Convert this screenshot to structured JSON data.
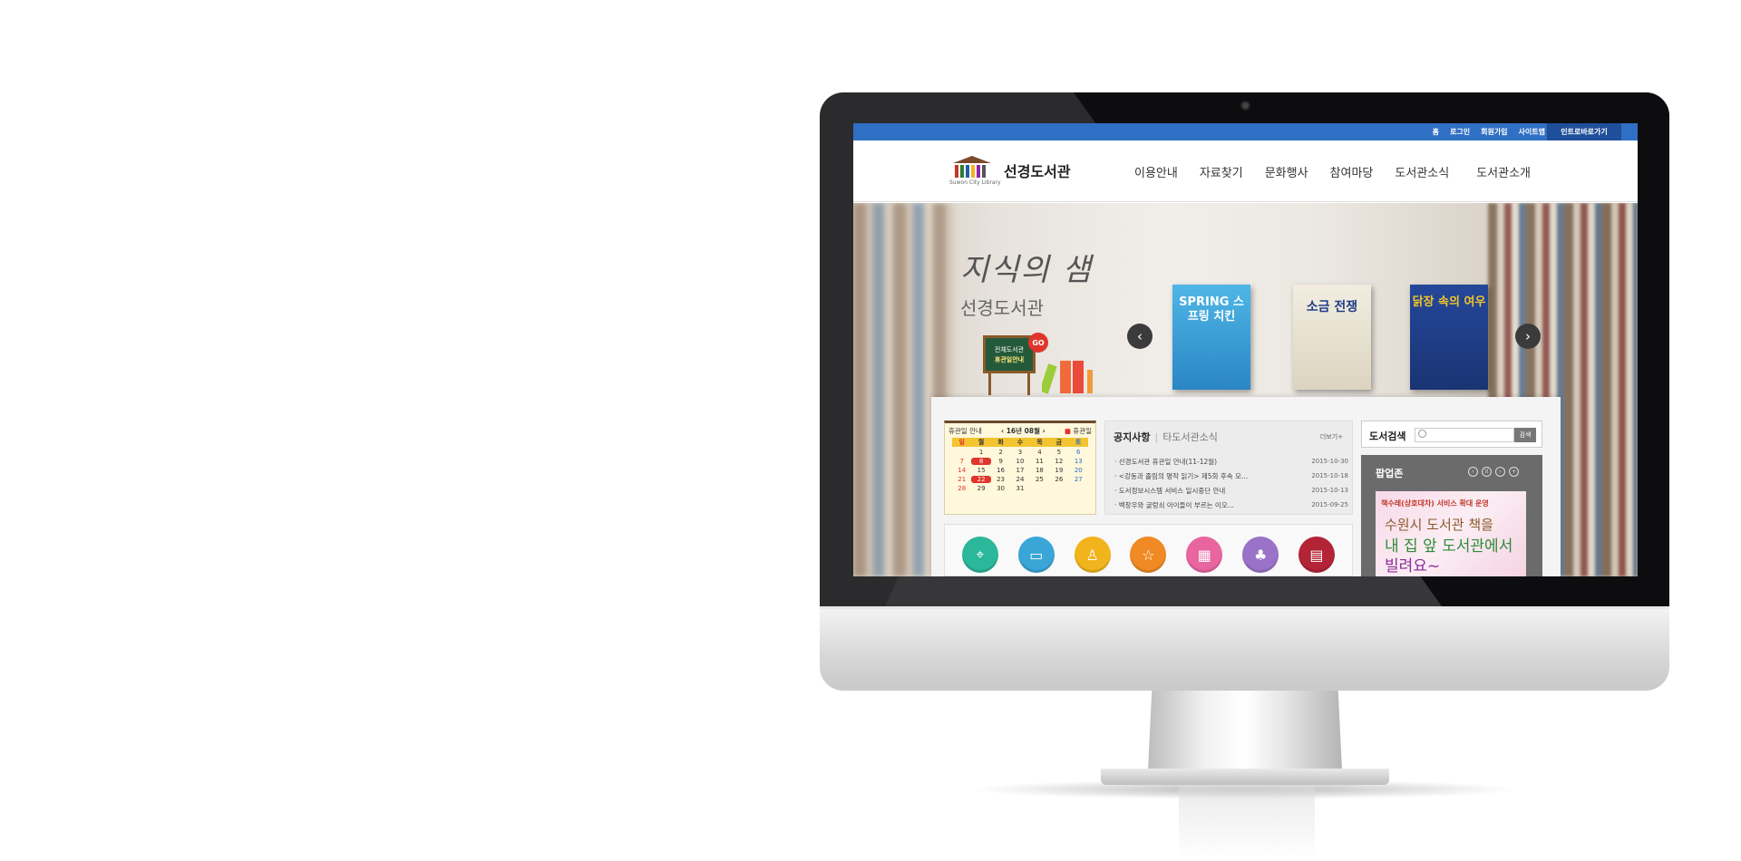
{
  "util_nav": [
    "홈",
    "로그인",
    "회원가입",
    "사이트맵"
  ],
  "intranet_label": "인트로바로가기",
  "logo": {
    "name": "선경도서관",
    "sub": "Suwon City Library"
  },
  "gnb": [
    "이용안내",
    "자료찾기",
    "문화행사",
    "참여마당",
    "도서관소식",
    "도서관소개"
  ],
  "hero": {
    "script_title": "지식의 샘",
    "title": "선경도서관",
    "board_line1": "전체도서관",
    "board_line2": "휴관일안내",
    "go_label": "GO",
    "books": [
      {
        "title": "SPRING 스프링 치킨",
        "color": "#3aa0d8"
      },
      {
        "title": "소금 전쟁",
        "color": "#e9e4d6"
      },
      {
        "title": "닭장 속의 여우",
        "color": "#1f3e8a"
      }
    ]
  },
  "calendar": {
    "title": "휴관일 안내",
    "month": "16년 08월",
    "legend": "휴관일",
    "dow": [
      "일",
      "월",
      "화",
      "수",
      "목",
      "금",
      "토"
    ],
    "days": [
      "",
      "1",
      "2",
      "3",
      "4",
      "5",
      "6",
      "7",
      "8",
      "9",
      "10",
      "11",
      "12",
      "13",
      "14",
      "15",
      "16",
      "17",
      "18",
      "19",
      "20",
      "21",
      "22",
      "23",
      "24",
      "25",
      "26",
      "27",
      "28",
      "29",
      "30",
      "31",
      "",
      "",
      ""
    ],
    "holidays": [
      "8",
      "22"
    ]
  },
  "notice": {
    "tab_active": "공지사항",
    "tab_other": "타도서관소식",
    "more": "더보기+",
    "items": [
      {
        "title": "선경도서관 휴관일 안내(11-12월)",
        "date": "2015-10-30"
      },
      {
        "title": "<강동과 졸림의 명작 읽기> 제5회 후속 모...",
        "date": "2015-10-18"
      },
      {
        "title": "도서정보시스템 서비스 일시중단 안내",
        "date": "2015-10-13"
      },
      {
        "title": "백창우와 굴렁쇠 아이들이 부르는 이오...",
        "date": "2015-09-25"
      }
    ]
  },
  "search": {
    "label": "도서검색",
    "placeholder": "",
    "button": "검색"
  },
  "popup": {
    "title": "팝업존",
    "controls": [
      "‹",
      "II",
      "›",
      "+"
    ],
    "line1": "책수레(상호대차) 서비스 확대 운영",
    "line2": "수원시 도서관 책을",
    "line3": "내 집 앞 도서관에서",
    "line4": "빌려요~"
  },
  "quick_icons": [
    {
      "name": "location-icon",
      "color": "#2bb79a",
      "glyph": "⌖"
    },
    {
      "name": "monitor-icon",
      "color": "#3aa6d8",
      "glyph": "▭"
    },
    {
      "name": "user-icon",
      "color": "#f2b41c",
      "glyph": "♙"
    },
    {
      "name": "star-icon",
      "color": "#f08a24",
      "glyph": "☆"
    },
    {
      "name": "calendar-icon",
      "color": "#e8659f",
      "glyph": "▦"
    },
    {
      "name": "sprout-icon",
      "color": "#9a73c8",
      "glyph": "♣"
    },
    {
      "name": "book-icon",
      "color": "#b32436",
      "glyph": "▤"
    }
  ]
}
